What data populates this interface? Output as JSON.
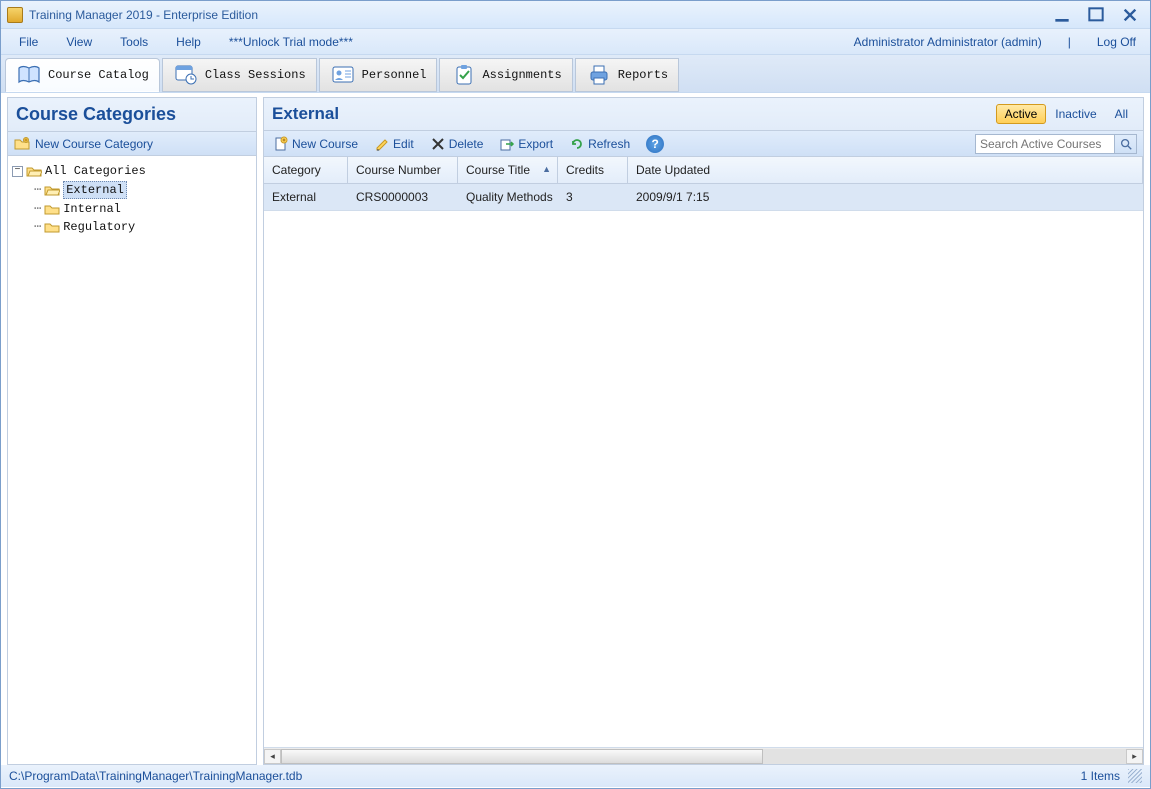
{
  "window": {
    "title": "Training Manager 2019 - Enterprise Edition"
  },
  "menu": {
    "items": [
      "File",
      "View",
      "Tools",
      "Help"
    ],
    "unlock": "***Unlock Trial mode***",
    "user": "Administrator Administrator (admin)",
    "logoff": "Log Off"
  },
  "tabs": {
    "items": [
      {
        "label": "Course Catalog"
      },
      {
        "label": "Class Sessions"
      },
      {
        "label": "Personnel"
      },
      {
        "label": "Assignments"
      },
      {
        "label": "Reports"
      }
    ]
  },
  "sidebar": {
    "title": "Course Categories",
    "new_label": "New Course Category",
    "tree": {
      "root": "All Categories",
      "children": [
        "External",
        "Internal",
        "Regulatory"
      ]
    }
  },
  "main": {
    "title": "External",
    "filters": {
      "active": "Active",
      "inactive": "Inactive",
      "all": "All"
    },
    "actions": {
      "new_course": "New Course",
      "edit": "Edit",
      "delete": "Delete",
      "export": "Export",
      "refresh": "Refresh"
    },
    "search_placeholder": "Search Active Courses",
    "columns": {
      "category": "Category",
      "number": "Course Number",
      "title": "Course Title",
      "credits": "Credits",
      "date": "Date Updated"
    },
    "rows": [
      {
        "category": "External",
        "number": "CRS0000003",
        "title": "Quality Methods",
        "credits": "3",
        "date": "2009/9/1 7:15"
      }
    ]
  },
  "status": {
    "path": "C:\\ProgramData\\TrainingManager\\TrainingManager.tdb",
    "count": "1 Items"
  }
}
